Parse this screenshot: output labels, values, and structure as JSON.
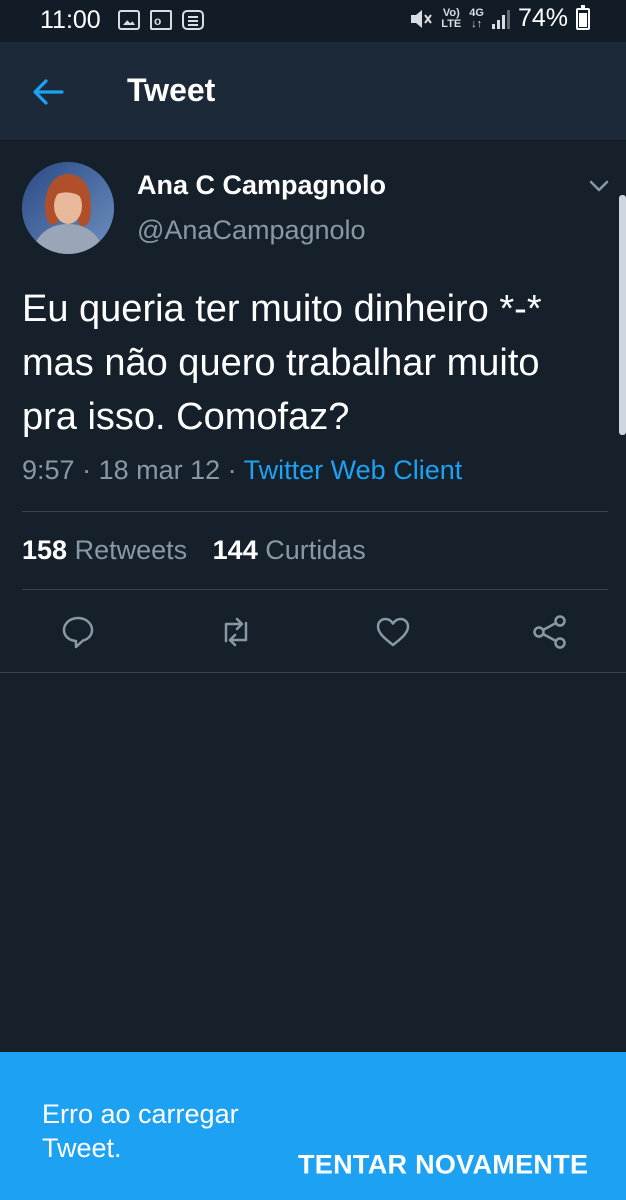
{
  "status_bar": {
    "time": "11:00",
    "volte_top": "Vo)",
    "volte_bottom": "LTE",
    "network_top": "4G",
    "network_bottom": "↓↑",
    "battery": "74%"
  },
  "header": {
    "title": "Tweet",
    "back_icon": "arrow-left-icon"
  },
  "tweet": {
    "author_name": "Ana C Campagnolo",
    "author_handle": "@AnaCampagnolo",
    "text": "Eu queria ter muito dinheiro *-*\nmas não quero trabalhar muito\npra isso. Comofaz?",
    "time": "9:57",
    "separator": " · ",
    "date": "18 mar 12",
    "client": "Twitter Web Client",
    "retweets_count": "158",
    "retweets_label": "Retweets",
    "likes_count": "144",
    "likes_label": "Curtidas"
  },
  "actions": [
    "reply-icon",
    "retweet-icon",
    "like-icon",
    "share-icon"
  ],
  "error_banner": {
    "message": "Erro ao carregar Tweet.",
    "button": "TENTAR NOVAMENTE"
  },
  "colors": {
    "background": "#15202b",
    "header": "#1c2938",
    "accent": "#1da1f2",
    "secondary_text": "#8899a6",
    "divider": "#38444d"
  }
}
